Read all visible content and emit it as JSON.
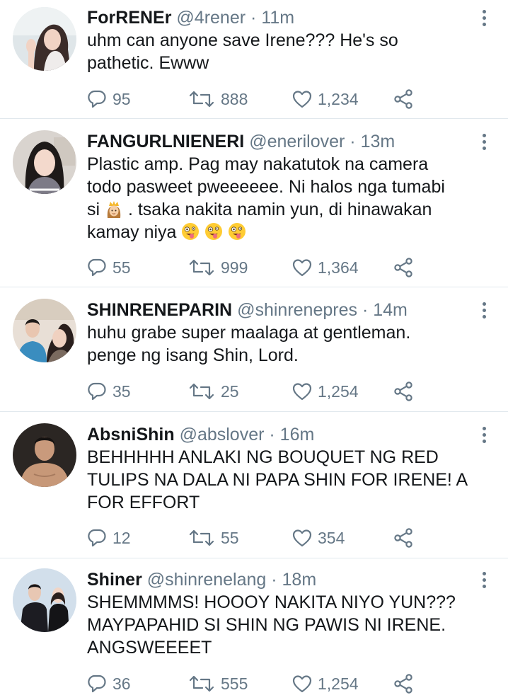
{
  "tweets": [
    {
      "name": "ForRENEr",
      "handle": "@4rener",
      "time": "11m",
      "text_lines": [
        "uhm can anyone save Irene??? He's so",
        "pathetic. Ewww"
      ],
      "replies": "95",
      "retweets": "888",
      "likes": "1,234"
    },
    {
      "name": "FANGURLNIENERI",
      "handle": "@enerilover",
      "time": "13m",
      "text_lines": [
        "Plastic amp. Pag may nakatutok na camera",
        "todo pasweet pweeeeee. Ni halos nga tumabi",
        "si",
        ". tsaka nakita namin yun, di hinawakan",
        "kamay niya"
      ],
      "replies": "55",
      "retweets": "999",
      "likes": "1,364"
    },
    {
      "name": "SHINRENEPARIN",
      "handle": "@shinrenepres",
      "time": "14m",
      "text_lines": [
        "huhu grabe super maalaga at gentleman.",
        "penge ng isang Shin, Lord."
      ],
      "replies": "35",
      "retweets": "25",
      "likes": "1,254"
    },
    {
      "name": "AbsniShin",
      "handle": "@abslover",
      "time": "16m",
      "text_lines": [
        "BEHHHHH ANLAKI NG BOUQUET NG RED",
        "TULIPS NA DALA NI PAPA SHIN FOR IRENE! A",
        "FOR EFFORT"
      ],
      "replies": "12",
      "retweets": "55",
      "likes": "354"
    },
    {
      "name": "Shiner",
      "handle": "@shinrenelang",
      "time": "18m",
      "text_lines": [
        "SHEMMMMS! HOOOY NAKITA NIYO YUN???",
        "MAYPAPAHID SI SHIN NG PAWIS NI IRENE.",
        "ANGSWEEEET"
      ],
      "replies": "36",
      "retweets": "555",
      "likes": "1,254"
    }
  ],
  "separator": "·",
  "icons": {
    "reply": "reply-icon",
    "retweet": "retweet-icon",
    "like": "heart-icon",
    "share": "share-icon",
    "more": "more-vertical-icon",
    "emoji_princess": "princess-emoji-icon",
    "emoji_zany": "zany-face-emoji-icon"
  },
  "colors": {
    "text": "#14171a",
    "muted": "#657786",
    "divider": "#e1e8ed"
  }
}
